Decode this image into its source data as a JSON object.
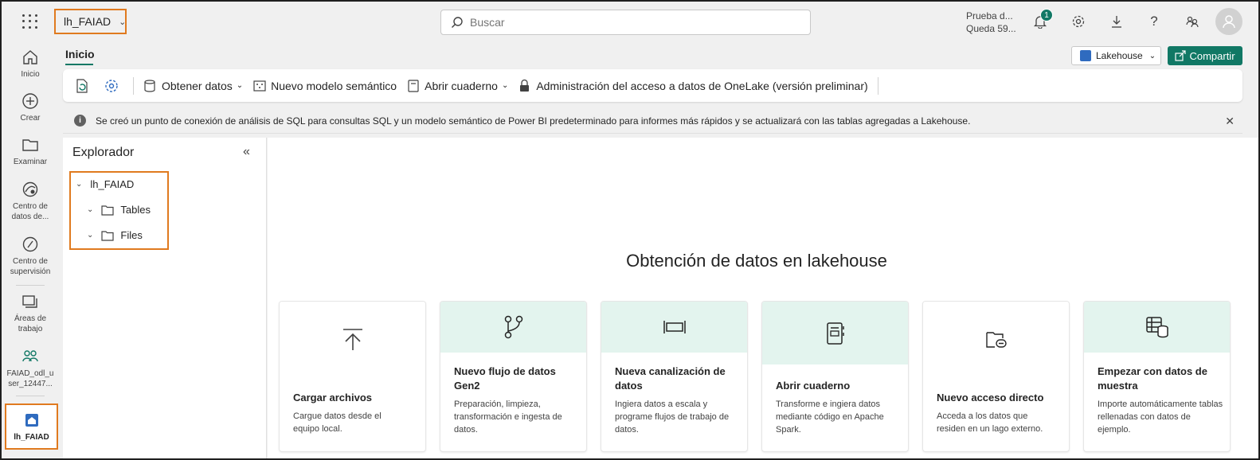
{
  "topbar": {
    "workspace": "lh_FAIAD",
    "search_placeholder": "Buscar",
    "trial_line1": "Prueba d...",
    "trial_line2": "Queda 59...",
    "notif_count": "1"
  },
  "rail": {
    "home": "Inicio",
    "create": "Crear",
    "browse": "Examinar",
    "datahub_1": "Centro de",
    "datahub_2": "datos de...",
    "monitor_1": "Centro de",
    "monitor_2": "supervisión",
    "workspaces_1": "Áreas de",
    "workspaces_2": "trabajo",
    "user_ws_1": "FAIAD_odl_u",
    "user_ws_2": "ser_12447...",
    "active": "lh_FAIAD"
  },
  "header": {
    "tab": "Inicio",
    "lakehouse_btn": "Lakehouse",
    "share_btn": "Compartir"
  },
  "ribbon": {
    "get_data": "Obtener datos",
    "new_model": "Nuevo modelo semántico",
    "open_notebook": "Abrir cuaderno",
    "access_mgmt": "Administración del acceso a datos de OneLake (versión preliminar)"
  },
  "info": {
    "message": "Se creó un punto de conexión de análisis de SQL para consultas SQL y un modelo semántico de Power BI predeterminado para informes más rápidos y se actualizará con las tablas agregadas a Lakehouse."
  },
  "explorer": {
    "title": "Explorador",
    "root": "lh_FAIAD",
    "tables": "Tables",
    "files": "Files"
  },
  "content": {
    "title": "Obtención de datos en lakehouse",
    "cards": [
      {
        "title": "Cargar archivos",
        "desc": "Cargue datos desde el equipo local.",
        "icon": "upload-icon"
      },
      {
        "title": "Nuevo flujo de datos Gen2",
        "desc": "Preparación, limpieza, transformación e ingesta de datos.",
        "icon": "dataflow-icon"
      },
      {
        "title": "Nueva canalización de datos",
        "desc": "Ingiera datos a escala y programe flujos de trabajo de datos.",
        "icon": "pipeline-icon"
      },
      {
        "title": "Abrir cuaderno",
        "desc": "Transforme e ingiera datos mediante código en Apache Spark.",
        "icon": "notebook-icon"
      },
      {
        "title": "Nuevo acceso directo",
        "desc": "Acceda a los datos que residen en un lago externo.",
        "icon": "shortcut-icon"
      },
      {
        "title": "Empezar con datos de muestra",
        "desc": "Importe automáticamente tablas rellenadas con datos de ejemplo.",
        "icon": "sample-data-icon"
      }
    ]
  },
  "colors": {
    "accent": "#117865",
    "highlight": "#e07a1f",
    "card_header": "#e3f4ee"
  }
}
